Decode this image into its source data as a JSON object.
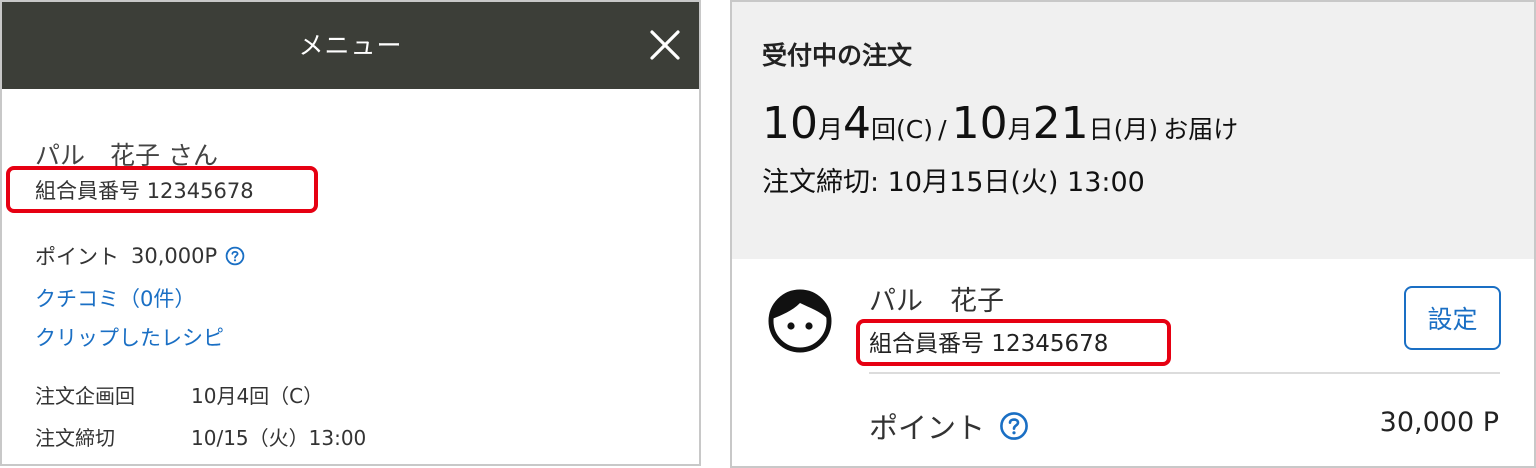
{
  "menu": {
    "title": "メニュー",
    "close_icon": "close-icon"
  },
  "left": {
    "user_name": "パル　花子 さん",
    "member_label": "組合員番号",
    "member_number": "12345678",
    "point_label": "ポイント",
    "point_value": "30,000P",
    "review_link": "クチコミ（0件）",
    "recipe_link": "クリップしたレシピ",
    "plan_label": "注文企画回",
    "plan_value": "10月4回（C）",
    "deadline_label": "注文締切",
    "deadline_value": "10/15（火）13:00"
  },
  "right": {
    "order_title": "受付中の注文",
    "delivery": {
      "plan_month": "10",
      "plan_month_unit": "月",
      "plan_no": "4",
      "plan_unit": "回(C)",
      "separator": "/",
      "day_month": "10",
      "day_month_unit": "月",
      "day": "21",
      "day_unit": "日(月)",
      "suffix": "お届け"
    },
    "deadline": "注文締切: 10月15日(火) 13:00",
    "user_name": "パル　花子",
    "member_label": "組合員番号",
    "member_number": "12345678",
    "settings_label": "設定",
    "point_label": "ポイント",
    "point_value": "30,000 P"
  },
  "colors": {
    "header_bg": "#3c3e38",
    "link_blue": "#1a6fc4",
    "highlight_red": "#e60012",
    "order_box_bg": "#f0f0f0"
  }
}
